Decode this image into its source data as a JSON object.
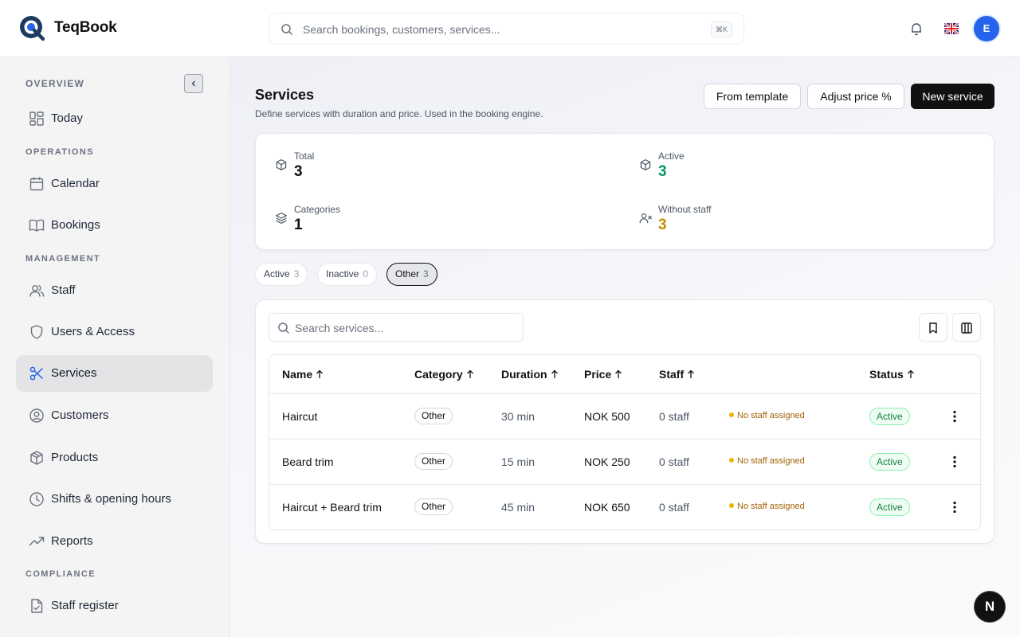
{
  "app": {
    "name": "TeqBook"
  },
  "header": {
    "search_placeholder": "Search bookings, customers, services...",
    "shortcut": "⌘K",
    "avatar_initial": "E"
  },
  "sidebar": {
    "sections": [
      "OVERVIEW",
      "OPERATIONS",
      "MANAGEMENT",
      "COMPLIANCE"
    ],
    "items": [
      {
        "label": "Today",
        "icon": "dashboard-icon"
      },
      {
        "label": "Calendar",
        "icon": "calendar-icon"
      },
      {
        "label": "Bookings",
        "icon": "book-icon"
      },
      {
        "label": "Staff",
        "icon": "users-icon"
      },
      {
        "label": "Users & Access",
        "icon": "shield-icon"
      },
      {
        "label": "Services",
        "icon": "scissors-icon",
        "active": true
      },
      {
        "label": "Customers",
        "icon": "user-circle-icon"
      },
      {
        "label": "Products",
        "icon": "package-icon"
      },
      {
        "label": "Shifts & opening hours",
        "icon": "clock-icon"
      },
      {
        "label": "Reports",
        "icon": "trending-icon"
      },
      {
        "label": "Staff register",
        "icon": "file-check-icon"
      }
    ]
  },
  "page": {
    "title": "Services",
    "subtitle": "Define services with duration and price. Used in the booking engine.",
    "buttons": {
      "template": "From template",
      "adjust": "Adjust price %",
      "new": "New service"
    }
  },
  "stats": {
    "total": {
      "label": "Total",
      "value": "3"
    },
    "active": {
      "label": "Active",
      "value": "3"
    },
    "categories": {
      "label": "Categories",
      "value": "1"
    },
    "without_staff": {
      "label": "Without staff",
      "value": "3"
    }
  },
  "filters": [
    {
      "label": "Active",
      "count": "3"
    },
    {
      "label": "Inactive",
      "count": "0"
    },
    {
      "label": "Other",
      "count": "3",
      "selected": true
    }
  ],
  "table": {
    "search_placeholder": "Search services...",
    "columns": {
      "name": "Name",
      "category": "Category",
      "duration": "Duration",
      "price": "Price",
      "staff": "Staff",
      "status": "Status"
    },
    "rows": [
      {
        "name": "Haircut",
        "category": "Other",
        "duration": "30 min",
        "price": "NOK 500",
        "staff": "0 staff",
        "warning": "No staff assigned",
        "status": "Active"
      },
      {
        "name": "Beard trim",
        "category": "Other",
        "duration": "15 min",
        "price": "NOK 250",
        "staff": "0 staff",
        "warning": "No staff assigned",
        "status": "Active"
      },
      {
        "name": "Haircut + Beard trim",
        "category": "Other",
        "duration": "45 min",
        "price": "NOK 650",
        "staff": "0 staff",
        "warning": "No staff assigned",
        "status": "Active"
      }
    ]
  },
  "colors": {
    "accent_blue": "#2563eb",
    "active_green": "#059669",
    "warning_amber": "#ca8a04"
  },
  "dev_badge": "N"
}
